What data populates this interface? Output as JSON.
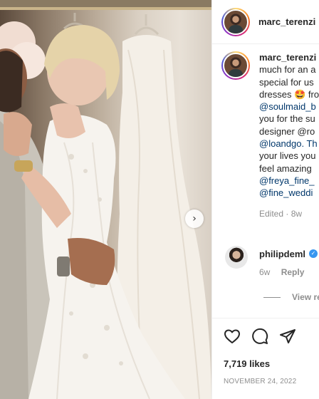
{
  "post": {
    "author": "marc_terenzi",
    "next_label": "›"
  },
  "caption": {
    "username": "marc_terenzi",
    "lines": [
      "much for an a",
      "special for us",
      "dresses 🤩 fro",
      "@soulmaid_b",
      "you for the su",
      "designer @ro",
      "@loandgo. Th",
      "your lives you",
      "feel amazing",
      "@freya_fine_",
      "@fine_weddi"
    ],
    "edited": "Edited · 8w"
  },
  "comment": {
    "username": "philipdeml",
    "verified_mark": "✓",
    "age": "6w",
    "reply_label": "Reply",
    "view_replies": "View re"
  },
  "actions": {
    "like_icon": "heart-icon",
    "comment_icon": "comment-icon",
    "share_icon": "paper-plane-icon"
  },
  "likes": "7,719 likes",
  "date": "NOVEMBER 24, 2022",
  "colors": {
    "mention": "#00376b",
    "muted": "#8e8e8e",
    "verified": "#3897f0"
  }
}
